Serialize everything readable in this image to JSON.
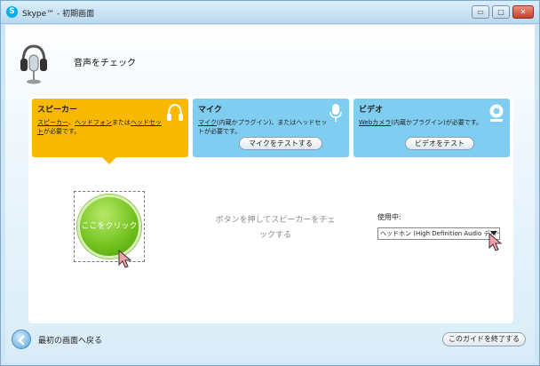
{
  "window": {
    "title": "Skype™ - 初期画面",
    "controls": {
      "minimize": "▭",
      "maximize": "□",
      "close": "✕"
    }
  },
  "header": {
    "title": "音声をチェック",
    "icon": "headset-microphone-icon"
  },
  "cards": {
    "speaker": {
      "title": "スピーカー",
      "desc_link1": "スピーカー",
      "desc_sep1": "、",
      "desc_link2": "ヘッドフォン",
      "desc_mid": "または",
      "desc_link3": "ヘッドセット",
      "desc_tail": "が必要です。",
      "icon": "headphones-icon",
      "color": "#f8b900"
    },
    "mic": {
      "title": "マイク",
      "desc_link": "マイク",
      "desc_tail": "(内蔵かプラグイン)、またはヘッドセットが必要です。",
      "button": "マイクをテストする",
      "icon": "microphone-icon",
      "color": "#80cdf2"
    },
    "video": {
      "title": "ビデオ",
      "desc_link": "Webカメラ",
      "desc_tail": "(内蔵かプラグイン)が必要です。",
      "button": "ビデオをテスト",
      "icon": "webcam-icon",
      "color": "#80cdf2"
    }
  },
  "speaker_test": {
    "button": "ここをクリック",
    "instruction": "ボタンを押してスピーカーをチェックする"
  },
  "device": {
    "label": "使用中:",
    "selected": "ヘッドホン (High Definition Audio デバイス)"
  },
  "footer": {
    "back_label": "最初の画面へ戻る",
    "exit_button": "このガイドを終了する"
  }
}
